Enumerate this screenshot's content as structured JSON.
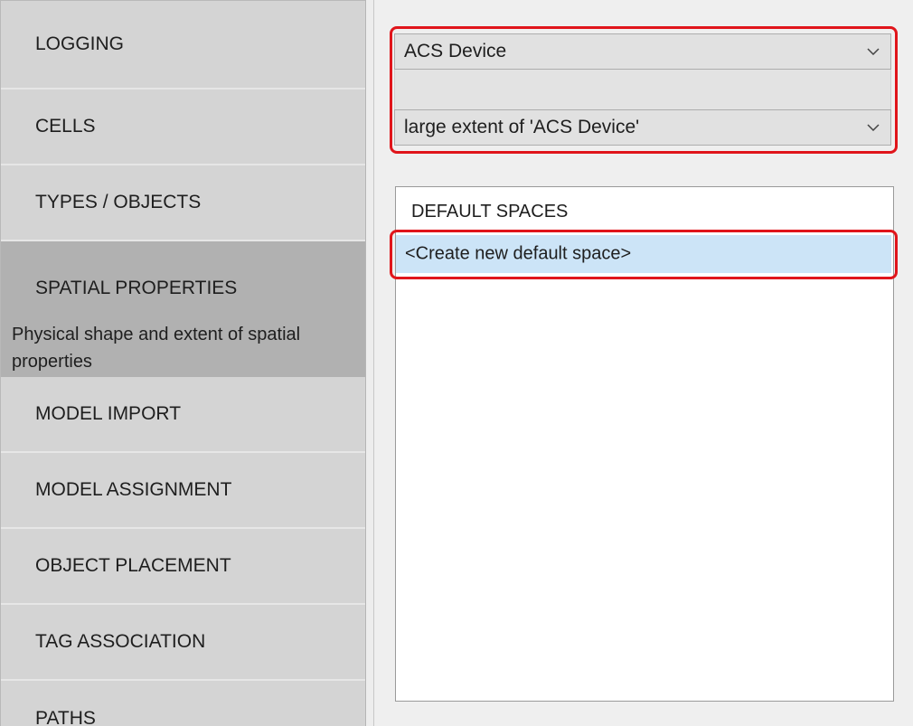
{
  "sidebar": {
    "items": [
      {
        "label": "LOGGING"
      },
      {
        "label": "CELLS"
      },
      {
        "label": "TYPES / OBJECTS"
      },
      {
        "label": "SPATIAL PROPERTIES",
        "description": "Physical shape and extent of spatial properties"
      },
      {
        "label": "MODEL IMPORT"
      },
      {
        "label": "MODEL ASSIGNMENT"
      },
      {
        "label": "OBJECT PLACEMENT"
      },
      {
        "label": "TAG ASSOCIATION"
      },
      {
        "label": "PATHS"
      }
    ],
    "active_index": 3
  },
  "content": {
    "type_select": {
      "value": "ACS Device",
      "icon": "chevron-down-icon"
    },
    "extent_select": {
      "value": "large extent of 'ACS Device'",
      "icon": "chevron-down-icon"
    },
    "default_spaces": {
      "header": "DEFAULT SPACES",
      "items": [
        {
          "label": "<Create new default space>",
          "selected": true
        }
      ]
    }
  },
  "colors": {
    "highlight": "#e0151b",
    "selection": "#cce4f7",
    "sidebar_active": "#b1b1b1",
    "sidebar_item": "#d4d4d4"
  }
}
